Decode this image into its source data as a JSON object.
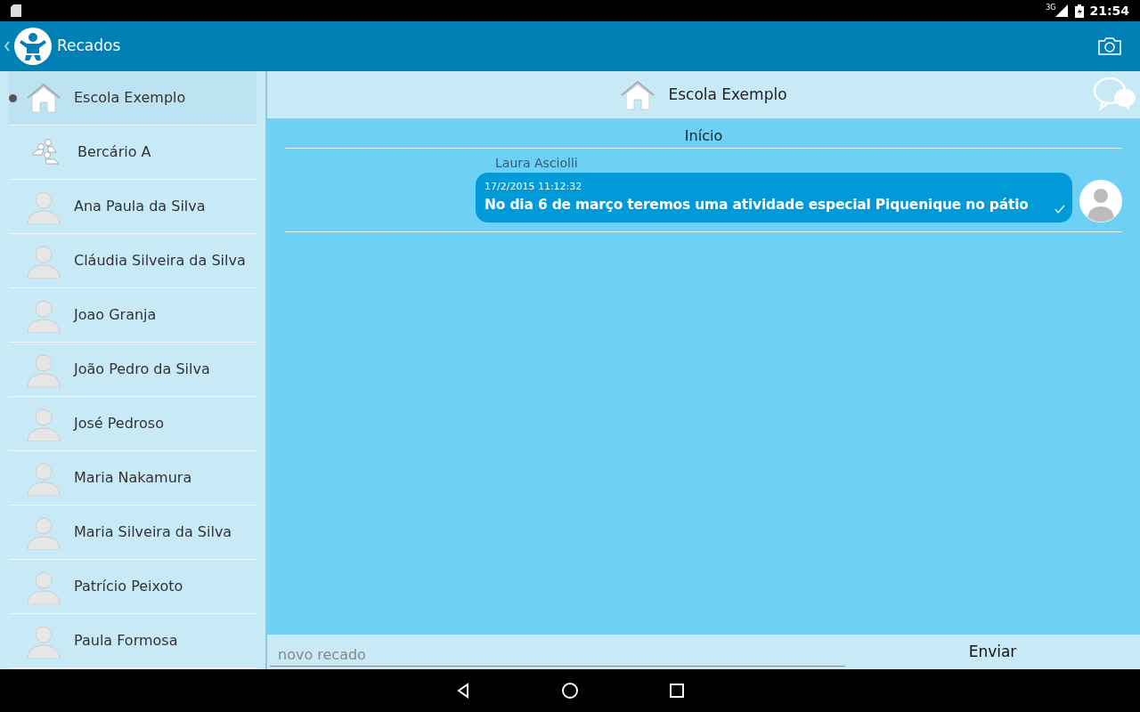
{
  "status_bar": {
    "network": "3G",
    "time": "21:54"
  },
  "app_bar": {
    "title": "Recados"
  },
  "sidebar": {
    "items": [
      {
        "kind": "school",
        "label": "Escola Exemplo",
        "selected": true
      },
      {
        "kind": "group",
        "label": "Bercário A",
        "selected": false
      },
      {
        "kind": "person",
        "label": "Ana Paula da Silva",
        "selected": false
      },
      {
        "kind": "person",
        "label": "Cláudia Silveira da Silva",
        "selected": false
      },
      {
        "kind": "person",
        "label": "Joao Granja",
        "selected": false
      },
      {
        "kind": "person",
        "label": "João Pedro da Silva",
        "selected": false
      },
      {
        "kind": "person",
        "label": "José Pedroso",
        "selected": false
      },
      {
        "kind": "person",
        "label": "Maria Nakamura",
        "selected": false
      },
      {
        "kind": "person",
        "label": "Maria Silveira da Silva",
        "selected": false
      },
      {
        "kind": "person",
        "label": "Patrício Peixoto",
        "selected": false
      },
      {
        "kind": "person",
        "label": "Paula Formosa",
        "selected": false
      }
    ]
  },
  "conversation": {
    "title": "Escola Exemplo",
    "section": "Início",
    "messages": [
      {
        "sender": "Laura Asciolli",
        "timestamp": "17/2/2015 11:12:32",
        "text": "No dia 6 de março teremos uma atividade especial Piquenique no pátio",
        "read": true
      }
    ]
  },
  "composer": {
    "placeholder": "novo recado",
    "send": "Enviar"
  }
}
